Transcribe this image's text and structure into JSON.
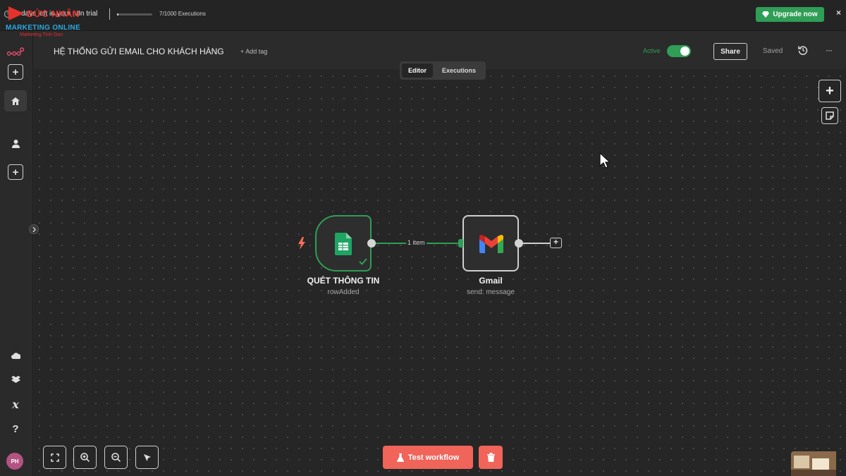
{
  "banner": {
    "trial_text": "days left in your n8n trial",
    "executions_text": "7/1000 Executions",
    "executions_used": 7,
    "executions_total": 1000,
    "upgrade_label": "Upgrade now",
    "close_label": "×"
  },
  "watermark": {
    "top_text": "ĐỨC NHÂN",
    "main_text": "MARKETING ONLINE",
    "sub_text": "Marketing Tinh Gọn"
  },
  "sidebar": {
    "items": [
      {
        "icon": "n8n-logo-icon"
      },
      {
        "icon": "plus-icon",
        "label": "+"
      },
      {
        "icon": "home-icon"
      },
      {
        "icon": "user-icon"
      },
      {
        "icon": "plus-icon",
        "label": "+"
      },
      {
        "icon": "cloud-icon"
      },
      {
        "icon": "templates-icon"
      },
      {
        "icon": "variables-icon",
        "label": "x"
      },
      {
        "icon": "help-icon",
        "label": "?"
      }
    ],
    "avatar_initials": "PH"
  },
  "header": {
    "workflow_name": "HỆ THỐNG GỬI EMAIL CHO KHÁCH HÀNG",
    "add_tag_label": "+ Add tag",
    "active_label": "Active",
    "active": true,
    "share_label": "Share",
    "saved_label": "Saved",
    "more_label": "···"
  },
  "tabs": [
    {
      "label": "Editor",
      "selected": true
    },
    {
      "label": "Executions",
      "selected": false
    }
  ],
  "nodes": [
    {
      "title": "QUÉT THÔNG TIN",
      "subtitle": "rowAdded",
      "icon": "google-sheets-icon",
      "status": "success"
    },
    {
      "title": "Gmail",
      "subtitle": "send: message",
      "icon": "gmail-icon"
    }
  ],
  "connection": {
    "label": "1 item"
  },
  "controls": {
    "test_workflow_label": "Test workflow"
  },
  "colors": {
    "accent_green": "#2f9e56",
    "danger_red": "#f0645a",
    "canvas_bg": "#262626"
  }
}
